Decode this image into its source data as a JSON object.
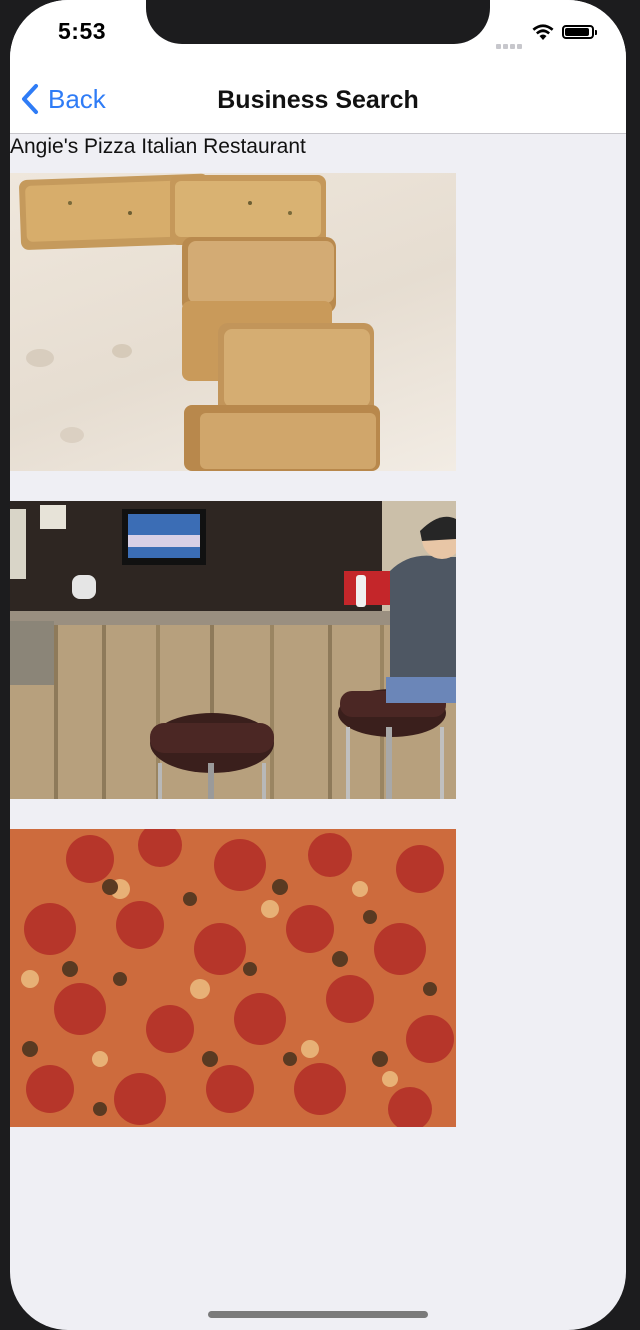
{
  "status_bar": {
    "time": "5:53"
  },
  "nav": {
    "back_label": "Back",
    "title": "Business Search"
  },
  "business": {
    "name": "Angie's Pizza Italian Restaurant"
  },
  "photos": [
    {
      "subject": "garlic bread slices on paper"
    },
    {
      "subject": "bar counter with stools and TV"
    },
    {
      "subject": "pepperoni and sausage pizza"
    }
  ],
  "colors": {
    "accent": "#2f7cf6",
    "background": "#efeff4",
    "navbar": "#ffffff"
  }
}
